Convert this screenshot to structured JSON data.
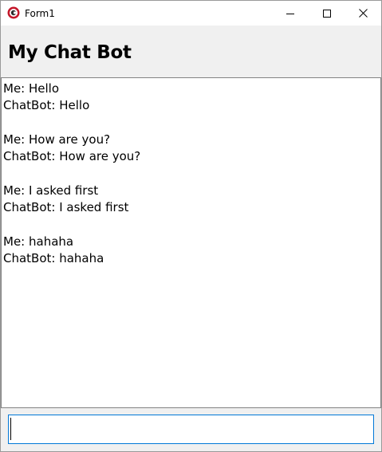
{
  "window": {
    "title": "Form1"
  },
  "header": {
    "title": "My Chat Bot"
  },
  "chat": {
    "exchanges": [
      {
        "me": "Me: Hello",
        "bot": "ChatBot: Hello"
      },
      {
        "me": "Me: How are you?",
        "bot": "ChatBot: How are you?"
      },
      {
        "me": "Me: I asked first",
        "bot": "ChatBot: I asked first"
      },
      {
        "me": "Me: hahaha",
        "bot": "ChatBot: hahaha"
      }
    ]
  },
  "input": {
    "value": ""
  },
  "colors": {
    "titlebar_bg": "#ffffff",
    "window_bg": "#f0f0f0",
    "focus_border": "#0078d7",
    "icon_red": "#c4172a"
  },
  "icons": {
    "app": "app-icon",
    "minimize": "minimize-icon",
    "maximize": "maximize-icon",
    "close": "close-icon"
  }
}
